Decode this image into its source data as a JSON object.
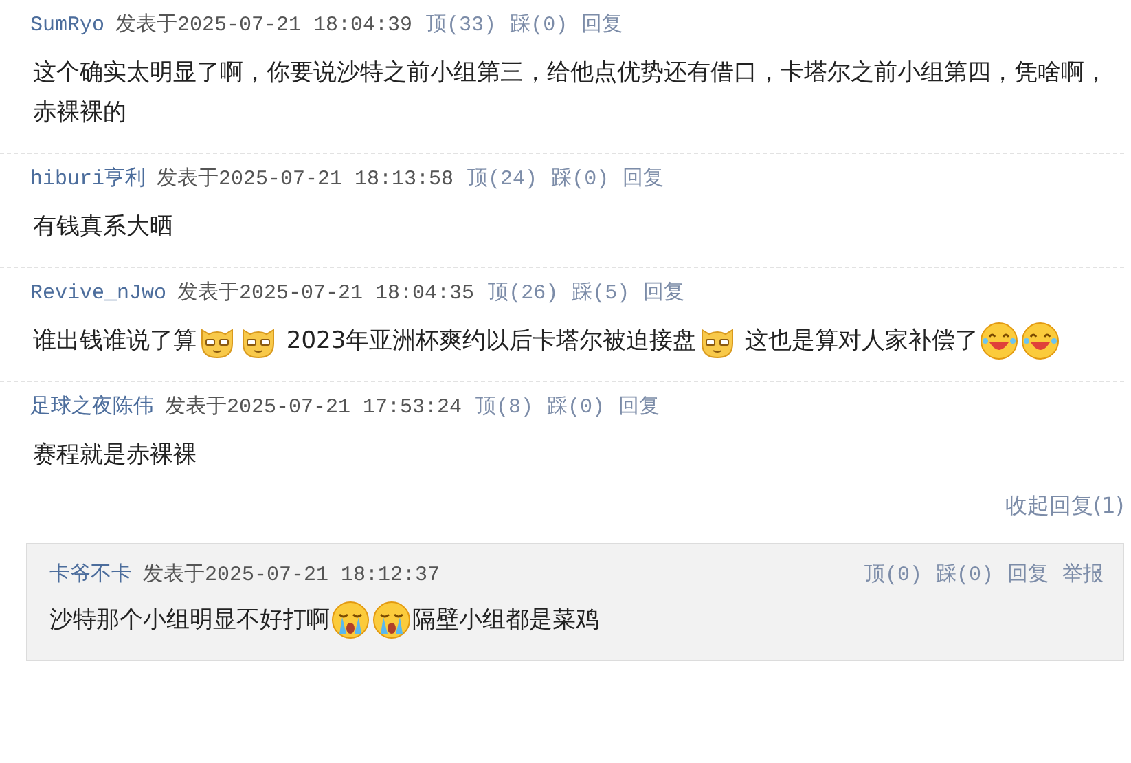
{
  "comments": [
    {
      "author": "SumRyo",
      "posted": "发表于2025-07-21 18:04:39",
      "up": "顶(33)",
      "down": "踩(0)",
      "reply": "回复",
      "body": [
        {
          "kind": "text",
          "text": "这个确实太明显了啊，你要说沙特之前小组第三，给他点优势还有借口，卡塔尔之前小组第四，凭啥啊，赤裸裸的"
        }
      ]
    },
    {
      "author": "hiburi亨利",
      "posted": "发表于2025-07-21 18:13:58",
      "up": "顶(24)",
      "down": "踩(0)",
      "reply": "回复",
      "body": [
        {
          "kind": "text",
          "text": "有钱真系大晒"
        }
      ]
    },
    {
      "author": "Revive_nJwo",
      "posted": "发表于2025-07-21 18:04:35",
      "up": "顶(26)",
      "down": "踩(5)",
      "reply": "回复",
      "body": [
        {
          "kind": "text",
          "text": "谁出钱谁说了算"
        },
        {
          "kind": "cat"
        },
        {
          "kind": "cat"
        },
        {
          "kind": "text",
          "text": " 2023年亚洲杯爽约以后卡塔尔被迫接盘"
        },
        {
          "kind": "cat"
        },
        {
          "kind": "text",
          "text": " 这也是算对人家补偿了"
        },
        {
          "kind": "laugh"
        },
        {
          "kind": "laugh"
        }
      ]
    },
    {
      "author": "足球之夜陈伟",
      "posted": "发表于2025-07-21 17:53:24",
      "up": "顶(8)",
      "down": "踩(0)",
      "reply": "回复",
      "body": [
        {
          "kind": "text",
          "text": "赛程就是赤裸裸"
        }
      ],
      "collapse": "收起回复(1)",
      "replies": [
        {
          "author": "卡爷不卡",
          "posted": "发表于2025-07-21 18:12:37",
          "up": "顶(0)",
          "down": "踩(0)",
          "reply": "回复",
          "report": "举报",
          "body": [
            {
              "kind": "text",
              "text": "沙特那个小组明显不好打啊"
            },
            {
              "kind": "cry"
            },
            {
              "kind": "cry"
            },
            {
              "kind": "text",
              "text": "隔壁小组都是菜鸡"
            }
          ]
        }
      ]
    }
  ]
}
